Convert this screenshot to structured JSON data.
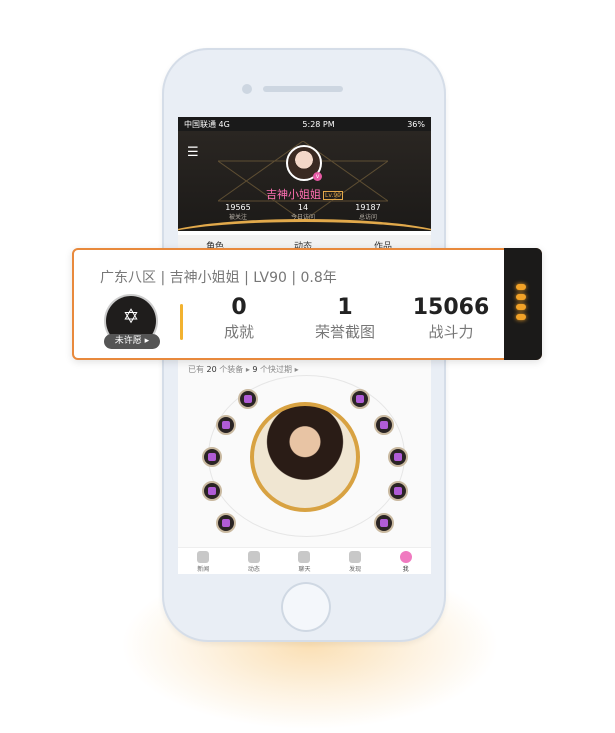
{
  "status": {
    "carrier": "中国联通",
    "network": "4G",
    "time": "5:28 PM",
    "battery": "36%"
  },
  "profile": {
    "nickname": "吉神小姐姐",
    "level_tag": "Lv.90",
    "stats": [
      {
        "value": "19565",
        "label": "被关注"
      },
      {
        "value": "14",
        "label": "今日访问"
      },
      {
        "value": "19187",
        "label": "总访问"
      }
    ]
  },
  "tabs": [
    "角色",
    "动态",
    "作品"
  ],
  "equipment": {
    "prefix": "已有",
    "count": "20",
    "unit": "个装备",
    "expire_count": "9",
    "expire_text": "个快过期"
  },
  "bottom_nav": [
    "新闻",
    "动态",
    "聊天",
    "发现",
    "我"
  ],
  "card": {
    "header": "广东八区 | 吉神小姐姐 | LV90 | 0.8年",
    "badge_label": "未许愿",
    "stats": [
      {
        "value": "0",
        "label": "成就"
      },
      {
        "value": "1",
        "label": "荣誉截图"
      },
      {
        "value": "15066",
        "label": "战斗力"
      }
    ]
  },
  "colors": {
    "accent": "#e8893c",
    "gold": "#f2b230",
    "pink": "#ff6fb2"
  }
}
